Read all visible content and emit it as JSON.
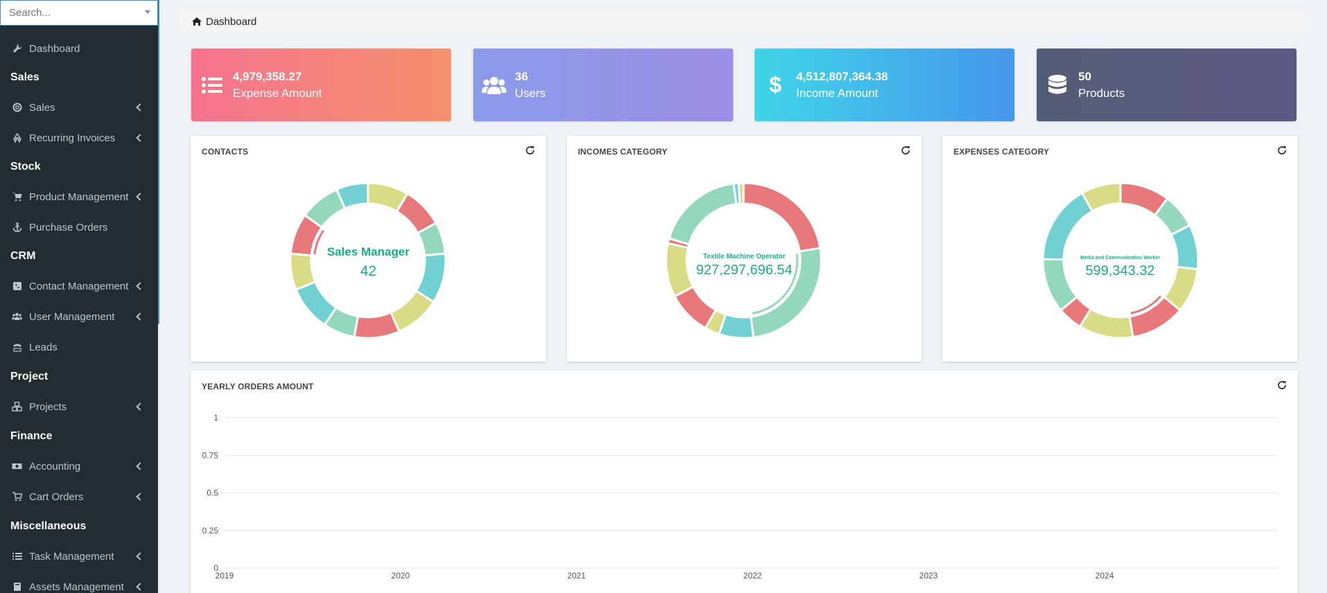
{
  "search": {
    "placeholder": "Search..."
  },
  "sidebar": {
    "dashboard": "Dashboard",
    "sections": {
      "sales": "Sales",
      "stock": "Stock",
      "crm": "CRM",
      "project": "Project",
      "finance": "Finance",
      "misc": "Miscellaneous"
    },
    "items": {
      "sales": "Sales",
      "recurring": "Recurring Invoices",
      "product_mgmt": "Product Management",
      "purchase_orders": "Purchase Orders",
      "contact_mgmt": "Contact Management",
      "user_mgmt": "User Management",
      "leads": "Leads",
      "projects": "Projects",
      "accounting": "Accounting",
      "cart_orders": "Cart Orders",
      "task_mgmt": "Task Management",
      "assets_mgmt": "Assets Management"
    }
  },
  "breadcrumb": {
    "label": "Dashboard"
  },
  "stats": [
    {
      "value": "4,979,358.27",
      "label": "Expense Amount",
      "icon": "list-icon"
    },
    {
      "value": "36",
      "label": "Users",
      "icon": "users-icon"
    },
    {
      "value": "4,512,807,364.38",
      "label": "Income Amount",
      "icon": "dollar-icon"
    },
    {
      "value": "50",
      "label": "Products",
      "icon": "database-icon"
    }
  ],
  "cards": {
    "contacts": {
      "title": "CONTACTS",
      "center_label": "Sales Manager",
      "center_value": "42"
    },
    "incomes": {
      "title": "INCOMES CATEGORY",
      "center_label": "Textile Machine Operator",
      "center_value": "927,297,696.54"
    },
    "expenses": {
      "title": "EXPENSES CATEGORY",
      "center_label": "Media and Communication Worker",
      "center_value": "599,343.32"
    },
    "yearly": {
      "title": "YEARLY ORDERS AMOUNT"
    }
  },
  "colors": {
    "red": "#e8787a",
    "green": "#93d8bb",
    "teal": "#70d0d2",
    "yellow": "#d9db85",
    "accent": "#1aab8a"
  },
  "chart_data": [
    {
      "type": "pie",
      "title": "CONTACTS",
      "slice_colors": [
        "#d9db85",
        "#e8787a",
        "#93d8bb",
        "#70d0d2",
        "#d9db85",
        "#e8787a",
        "#93d8bb",
        "#70d0d2",
        "#d9db85",
        "#e8787a",
        "#93d8bb",
        "#70d0d2"
      ],
      "values": [
        9,
        9,
        7,
        11,
        10,
        10,
        7,
        10,
        8,
        9,
        9,
        7
      ],
      "highlight_index": 9
    },
    {
      "type": "pie",
      "title": "INCOMES CATEGORY",
      "slice_colors": [
        "#e8787a",
        "#93d8bb",
        "#70d0d2",
        "#d9db85",
        "#e8787a",
        "#d9db85",
        "#e8787a",
        "#93d8bb",
        "#70d0d2",
        "#d9db85"
      ],
      "values": [
        22,
        25,
        7,
        3,
        9,
        11,
        1,
        18,
        1,
        1
      ],
      "highlight_index": 1
    },
    {
      "type": "pie",
      "title": "EXPENSES CATEGORY",
      "slice_colors": [
        "#e8787a",
        "#93d8bb",
        "#70d0d2",
        "#d9db85",
        "#e8787a",
        "#d9db85",
        "#e8787a",
        "#93d8bb",
        "#70d0d2",
        "#d9db85"
      ],
      "values": [
        10,
        7,
        9,
        9,
        11,
        11,
        5,
        11,
        16,
        8
      ],
      "highlight_index": 4
    },
    {
      "type": "line",
      "title": "YEARLY ORDERS AMOUNT",
      "x": [
        "2019",
        "2020",
        "2021",
        "2022",
        "2023",
        "2024"
      ],
      "yticks": [
        "0",
        "0.25",
        "0.5",
        "0.75",
        "1"
      ],
      "ylim": [
        0,
        1
      ],
      "grid": true,
      "series": []
    }
  ]
}
